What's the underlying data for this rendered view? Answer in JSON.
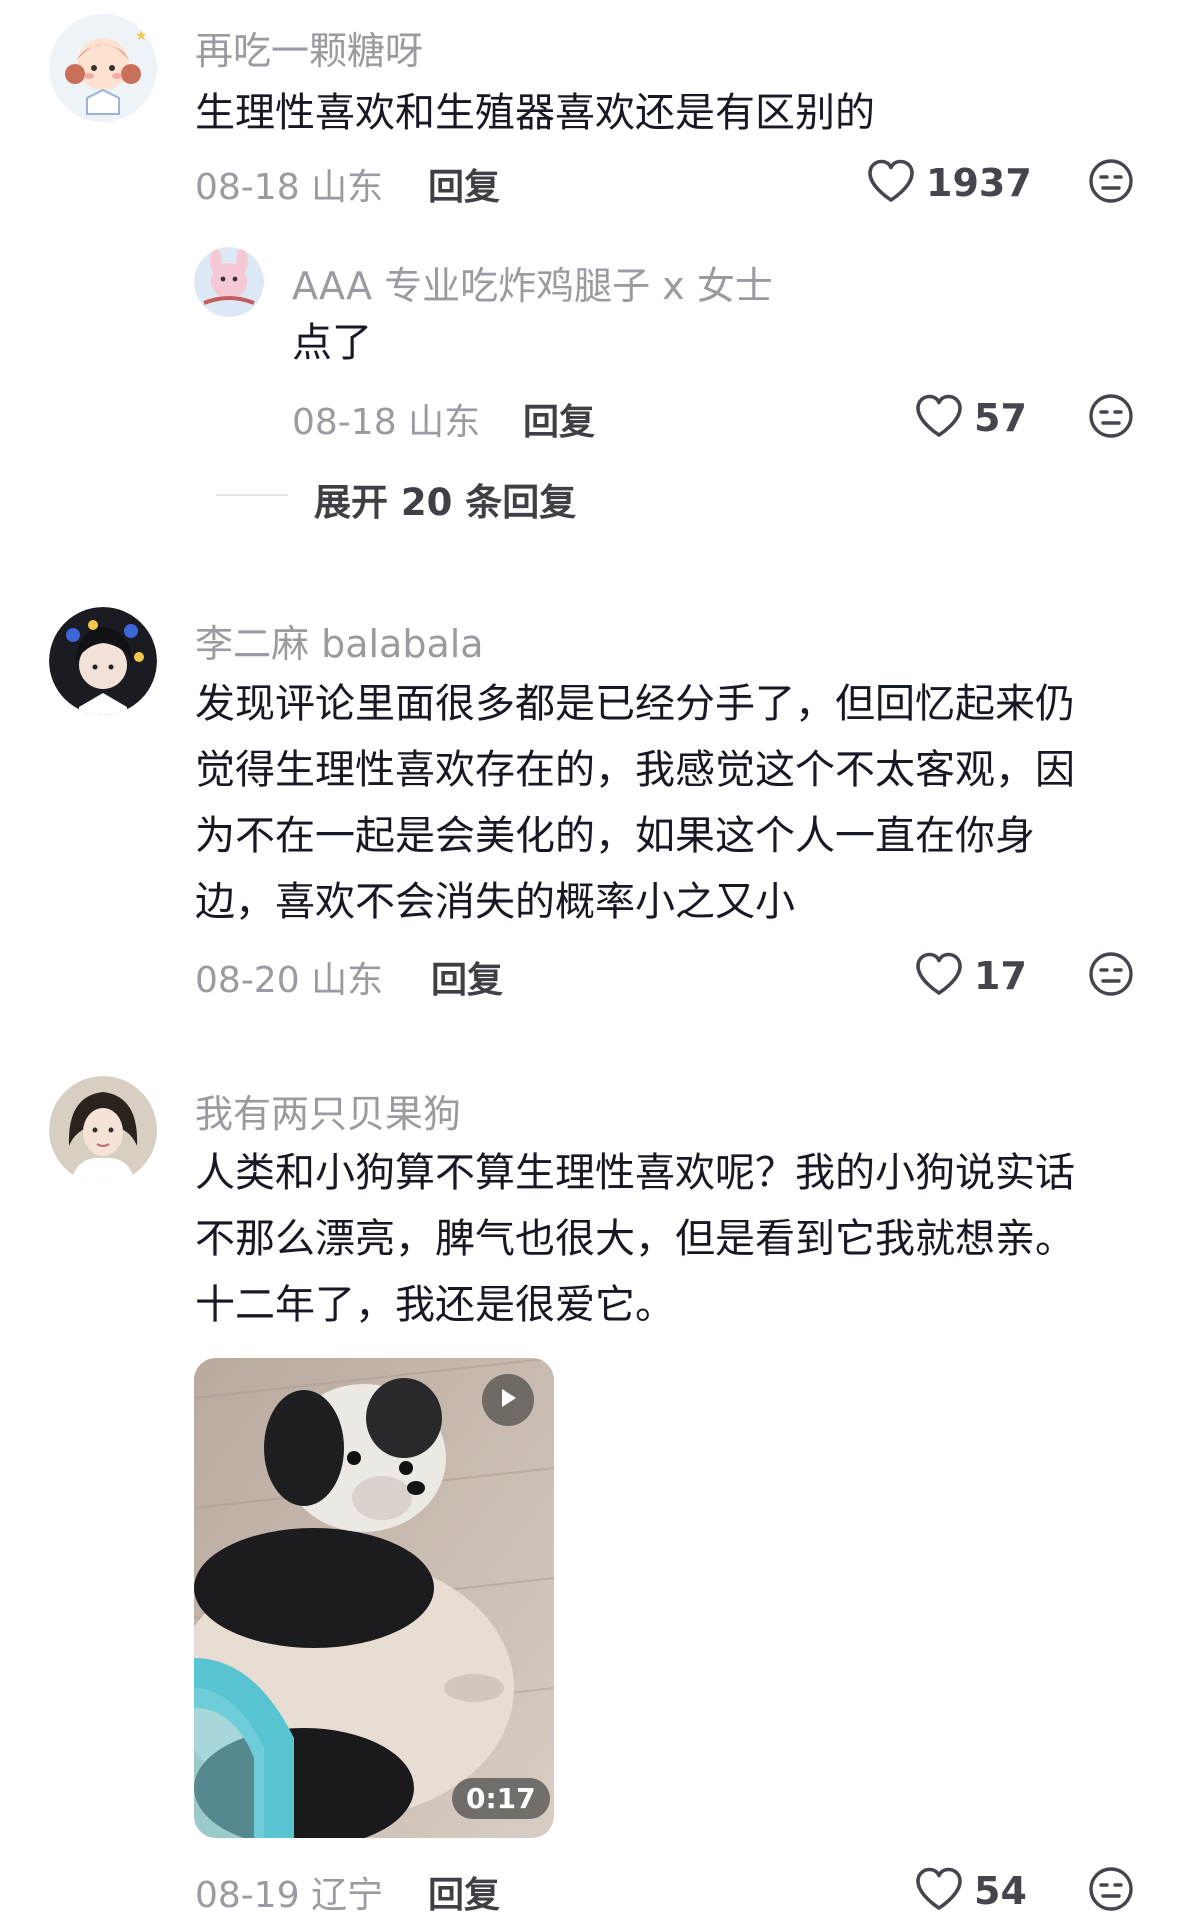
{
  "comments": [
    {
      "username": "再吃一颗糖呀",
      "text": "生理性喜欢和生殖器喜欢还是有区别的",
      "date": "08-18",
      "location": "山东",
      "reply_label": "回复",
      "likes": "1937",
      "replies": [
        {
          "username": "AAA 专业吃炸鸡腿子 x 女士",
          "text": "点了",
          "date": "08-18",
          "location": "山东",
          "reply_label": "回复",
          "likes": "57"
        }
      ],
      "expand_label": "展开 20 条回复"
    },
    {
      "username": "李二麻 balabala",
      "text_lines": [
        "发现评论里面很多都是已经分手了，但回忆起来仍",
        "觉得生理性喜欢存在的，我感觉这个不太客观，因",
        "为不在一起是会美化的，如果这个人一直在你身",
        "边，喜欢不会消失的概率小之又小"
      ],
      "date": "08-20",
      "location": "山东",
      "reply_label": "回复",
      "likes": "17"
    },
    {
      "username": "我有两只贝果狗",
      "text_lines": [
        "人类和小狗算不算生理性喜欢呢？我的小狗说实话",
        "不那么漂亮，脾气也很大，但是看到它我就想亲。",
        "十二年了，我还是很爱它。"
      ],
      "video_duration": "0:17",
      "date": "08-19",
      "location": "辽宁",
      "reply_label": "回复",
      "likes": "54"
    }
  ],
  "icons": {
    "like": "heart-outline-icon",
    "dislike": "dislike-face-icon",
    "play": "play-icon"
  },
  "colors": {
    "username": "#9a9aa1",
    "text": "#161823",
    "meta": "#9a9aa1"
  }
}
